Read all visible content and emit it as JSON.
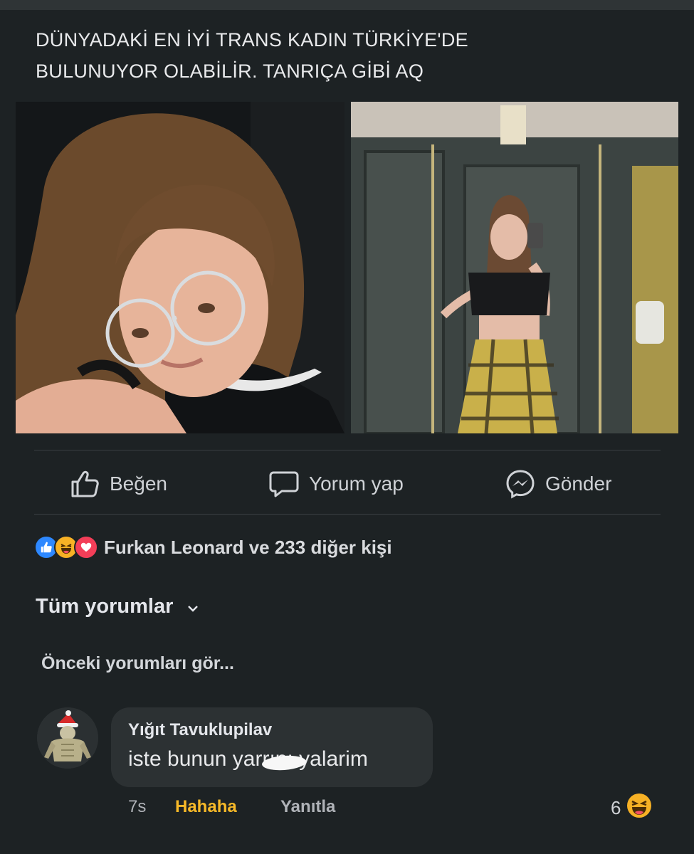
{
  "post": {
    "text_line1": "DÜNYADAKİ EN İYİ TRANS KADIN TÜRKİYE'DE",
    "text_line2": "BULUNUYOR OLABİLİR. TANRIÇA GİBİ AQ"
  },
  "actions": {
    "like": "Beğen",
    "comment": "Yorum yap",
    "send": "Gönder"
  },
  "reactions": {
    "icons": [
      "like-icon",
      "haha-icon",
      "love-icon"
    ],
    "summary": "Furkan Leonard ve 233 diğer kişi"
  },
  "comments": {
    "filter_label": "Tüm yorumlar",
    "previous_label": "Önceki yorumları gör...",
    "items": [
      {
        "author": "Yığıt Tavuklupilav",
        "text": "iste bunun yarrını yalarim",
        "time": "7s",
        "reaction_label": "Hahaha",
        "reply_label": "Yanıtla",
        "reaction_count": "6"
      }
    ]
  },
  "colors": {
    "background": "#1d2224",
    "bubble": "#2c3133",
    "like_blue": "#2d88ff",
    "love_red": "#f33e58",
    "haha_yellow": "#f7b125"
  }
}
